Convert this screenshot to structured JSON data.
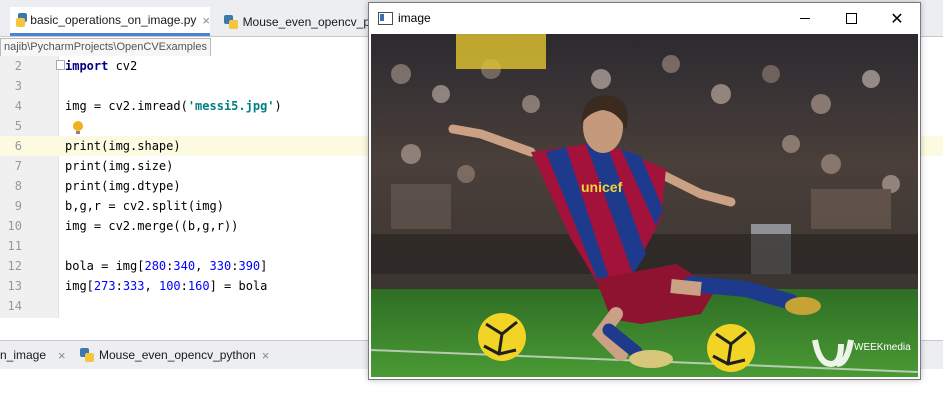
{
  "ide": {
    "tabs": [
      {
        "label": "basic_operations_on_image.py",
        "close": "×",
        "active": true
      },
      {
        "label": "Mouse_even_opencv_py",
        "close": "",
        "active": false
      }
    ],
    "path_tooltip": "najib\\PycharmProjects\\OpenCVExamples",
    "lines": [
      {
        "num": "2",
        "text": "import cv2"
      },
      {
        "num": "3",
        "text": ""
      },
      {
        "num": "4",
        "text": "img = cv2.imread('messi5.jpg')"
      },
      {
        "num": "5",
        "text": ""
      },
      {
        "num": "6",
        "text": "print(img.shape)"
      },
      {
        "num": "7",
        "text": "print(img.size)"
      },
      {
        "num": "8",
        "text": "print(img.dtype)"
      },
      {
        "num": "9",
        "text": "b,g,r = cv2.split(img)"
      },
      {
        "num": "10",
        "text": "img = cv2.merge((b,g,r))"
      },
      {
        "num": "11",
        "text": ""
      },
      {
        "num": "12",
        "text": "bola = img[280:340, 330:390]"
      },
      {
        "num": "13",
        "text": "img[273:333, 100:160] = bola"
      },
      {
        "num": "14",
        "text": ""
      }
    ],
    "current_line": "6",
    "bottom_tabs": [
      {
        "label": "n_image",
        "close": "×"
      },
      {
        "label": "Mouse_even_opencv_python",
        "close": "×"
      }
    ]
  },
  "image_window": {
    "title": "image",
    "minimize": "minimize",
    "maximize": "maximize",
    "close": "✕",
    "photo": {
      "shirt_text": "unicef",
      "watermark": "WEEKmedia"
    }
  },
  "colors": {
    "accent": "#4a83d6",
    "keyword": "#000080",
    "string": "#008080",
    "number": "#0000ff",
    "pitch": "#3f8a2a",
    "jersey_red": "#a3123a",
    "jersey_blue": "#1e3a8c"
  }
}
